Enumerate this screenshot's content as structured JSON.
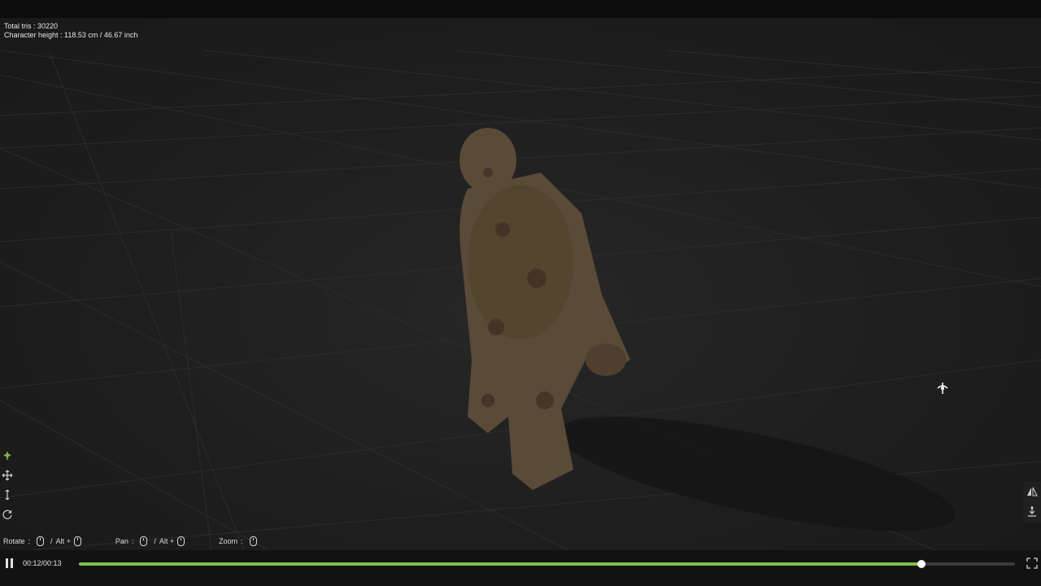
{
  "info": {
    "total_tris": "Total tris : 30220",
    "character_height": "Character height : 118.53 cm / 46.67 inch"
  },
  "hints": {
    "rotate_label": "Rotate",
    "pan_label": "Pan",
    "zoom_label": "Zoom",
    "colon": ":",
    "slash": "/",
    "alt_plus": "Alt +"
  },
  "tools_left": [
    "rotate-tool-icon",
    "pan-move-tool-icon",
    "vertical-move-tool-icon",
    "reset-rotate-icon"
  ],
  "tools_right": [
    "mirror-icon",
    "ground-anchor-icon"
  ],
  "player": {
    "time": "00:12/00:13",
    "progress": 0.9
  },
  "colors": {
    "accent": "#79c24a",
    "background": "#1b1b1b",
    "character": "#5a4a38"
  }
}
